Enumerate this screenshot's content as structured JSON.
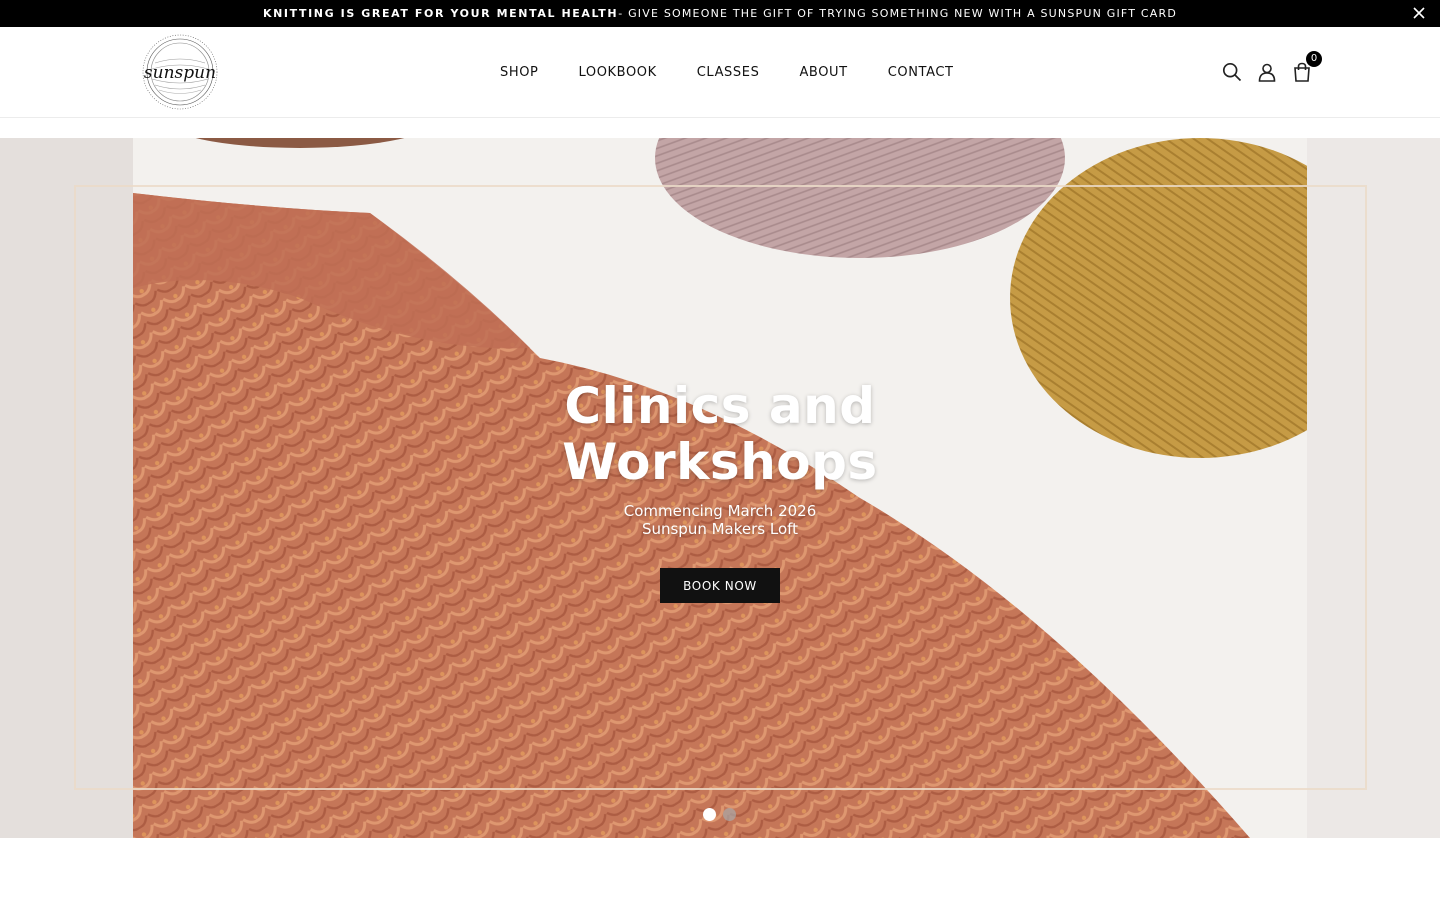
{
  "announcement": {
    "strong_text": "KNITTING IS GREAT FOR YOUR MENTAL HEALTH",
    "text": " - GIVE SOMEONE THE GIFT OF TRYING SOMETHING NEW WITH A SUNSPUN GIFT CARD",
    "close_icon": "close-icon"
  },
  "header": {
    "logo_text": "sunspun",
    "nav": [
      "SHOP",
      "LOOKBOOK",
      "CLASSES",
      "ABOUT",
      "CONTACT"
    ],
    "icons": [
      "search-icon",
      "account-icon",
      "bag-icon"
    ],
    "cart_count": "0"
  },
  "hero": {
    "title_line1": "Clinics and",
    "title_line2": "Workshops",
    "sub_line1": "Commencing March 2026",
    "sub_line2": "Sunspun Makers Loft",
    "button_label": "BOOK NOW",
    "slides_total": 2,
    "active_slide": 1
  },
  "colors": {
    "announcement_bg": "#000000",
    "button_bg": "#111111",
    "sweater": "#c97a5e",
    "yarn_mustard": "#c69b45",
    "yarn_pink": "#c3a5a6"
  }
}
